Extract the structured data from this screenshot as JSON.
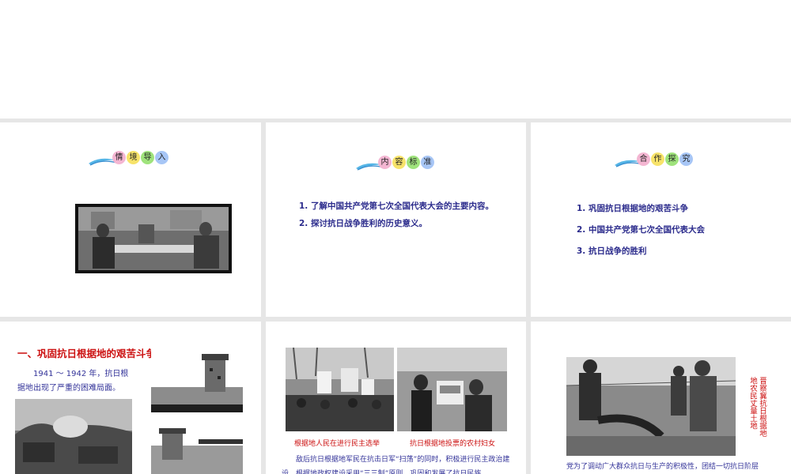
{
  "slides": {
    "s1": {
      "badge": [
        "情",
        "境",
        "导",
        "入"
      ]
    },
    "s2": {
      "badge": [
        "内",
        "容",
        "标",
        "准"
      ],
      "items": [
        "1. 了解中国共产党第七次全国代表大会的主要内容。",
        "2. 探讨抗日战争胜利的历史意义。"
      ]
    },
    "s3": {
      "badge": [
        "合",
        "作",
        "探",
        "究"
      ],
      "items": [
        "1. 巩固抗日根据地的艰苦斗争",
        "2. 中国共产党第七次全国代表大会",
        "3. 抗日战争的胜利"
      ]
    },
    "s4": {
      "title": "一、巩固抗日根据地的艰苦斗争",
      "body": "1941 ～ 1942 年，抗日根据地出现了严重的困难局面。"
    },
    "s5": {
      "caption_left": "根据地人民在进行民主选举",
      "caption_right": "抗日根据地投票的农村妇女",
      "body": "敌后抗日根据地军民在抗击日军“扫荡”的同时，积极进行民主政治建设。根据地政权建设采用“三三制”原则，巩固和发展了抗日民族"
    },
    "s6": {
      "vertical_left": "地农民丈量土地",
      "vertical_right": "晋察冀抗日根据地",
      "body": "党为了调动广大群众抗日与生产的积极性，团结一切抗日阶层"
    }
  }
}
